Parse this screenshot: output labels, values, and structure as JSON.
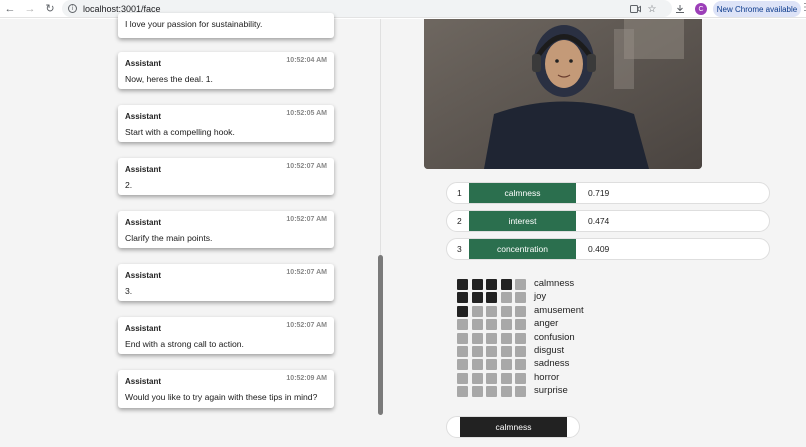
{
  "browser": {
    "url": "localhost:3001/face",
    "new_chrome_label": "New Chrome available",
    "avatar_letter": "C"
  },
  "chat": {
    "partial_message": "I love your passion for sustainability.",
    "messages": [
      {
        "sender": "Assistant",
        "time": "10:52:04 AM",
        "text": "Now, heres the deal. 1."
      },
      {
        "sender": "Assistant",
        "time": "10:52:05 AM",
        "text": "Start with a compelling hook."
      },
      {
        "sender": "Assistant",
        "time": "10:52:07 AM",
        "text": "2."
      },
      {
        "sender": "Assistant",
        "time": "10:52:07 AM",
        "text": "Clarify the main points."
      },
      {
        "sender": "Assistant",
        "time": "10:52:07 AM",
        "text": "3."
      },
      {
        "sender": "Assistant",
        "time": "10:52:07 AM",
        "text": "End with a strong call to action."
      },
      {
        "sender": "Assistant",
        "time": "10:52:09 AM",
        "text": "Would you like to try again with these tips in mind?"
      }
    ]
  },
  "top_emotions": [
    {
      "rank": "1",
      "name": "calmness",
      "score": "0.719"
    },
    {
      "rank": "2",
      "name": "interest",
      "score": "0.474"
    },
    {
      "rank": "3",
      "name": "concentration",
      "score": "0.409"
    }
  ],
  "emotion_grid": [
    {
      "name": "calmness",
      "level": 4
    },
    {
      "name": "joy",
      "level": 3
    },
    {
      "name": "amusement",
      "level": 1
    },
    {
      "name": "anger",
      "level": 0
    },
    {
      "name": "confusion",
      "level": 0
    },
    {
      "name": "disgust",
      "level": 0
    },
    {
      "name": "sadness",
      "level": 0
    },
    {
      "name": "horror",
      "level": 0
    },
    {
      "name": "surprise",
      "level": 0
    }
  ],
  "current_emotion": "calmness",
  "colors": {
    "rank_bar": "#2b6f4e",
    "grid_active": "#222222",
    "grid_inactive": "#a8a8a8"
  }
}
